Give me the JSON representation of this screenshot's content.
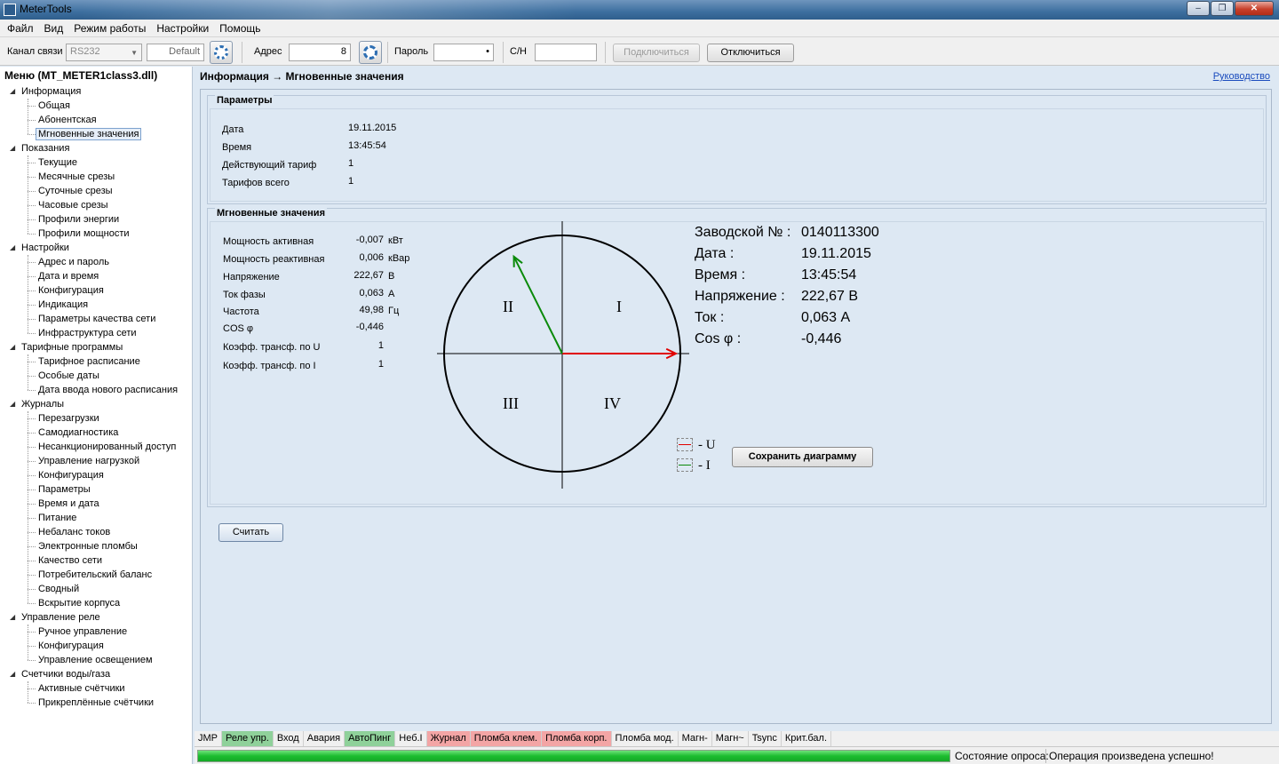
{
  "window": {
    "title": "MeterTools",
    "minimize": "–",
    "maximize": "❐",
    "close": "✕"
  },
  "menu": [
    "Файл",
    "Вид",
    "Режим работы",
    "Настройки",
    "Помощь"
  ],
  "toolbar": {
    "channel_label": "Канал связи",
    "channel_value": "RS232",
    "profile_value": "Default",
    "address_label": "Адрес",
    "address_value": "8",
    "password_label": "Пароль",
    "password_value": "•",
    "serial_label": "С/Н",
    "serial_value": "",
    "connect_label": "Подключиться",
    "disconnect_label": "Отключиться"
  },
  "sidebar": {
    "title": "Меню (MT_METER1class3.dll)",
    "groups": [
      {
        "label": "Информация",
        "items": [
          "Общая",
          "Абонентская",
          "Мгновенные значения"
        ],
        "selected": 2
      },
      {
        "label": "Показания",
        "items": [
          "Текущие",
          "Месячные срезы",
          "Суточные срезы",
          "Часовые срезы",
          "Профили энергии",
          "Профили мощности"
        ]
      },
      {
        "label": "Настройки",
        "items": [
          "Адрес и пароль",
          "Дата и время",
          "Конфигурация",
          "Индикация",
          "Параметры качества сети",
          "Инфраструктура сети"
        ]
      },
      {
        "label": "Тарифные программы",
        "items": [
          "Тарифное расписание",
          "Особые даты",
          "Дата ввода нового расписания"
        ]
      },
      {
        "label": "Журналы",
        "items": [
          "Перезагрузки",
          "Самодиагностика",
          "Несанкционированный доступ",
          "Управление нагрузкой",
          "Конфигурация",
          "Параметры",
          "Время и дата",
          "Питание",
          "Небаланс токов",
          "Электронные пломбы",
          "Качество сети",
          "Потребительский баланс",
          "Сводный",
          "Вскрытие корпуса"
        ]
      },
      {
        "label": "Управление реле",
        "items": [
          "Ручное управление",
          "Конфигурация",
          "Управление освещением"
        ]
      },
      {
        "label": "Счетчики воды/газа",
        "items": [
          "Активные счётчики",
          "Прикреплённые счётчики"
        ]
      }
    ]
  },
  "main": {
    "header": "Информация → Мгновенные значения",
    "help_link": "Руководство",
    "params": {
      "title": "Параметры",
      "rows": [
        {
          "label": "Дата",
          "value": "19.11.2015"
        },
        {
          "label": "Время",
          "value": "13:45:54"
        },
        {
          "label": "Действующий тариф",
          "value": "1"
        },
        {
          "label": "Тарифов всего",
          "value": "1"
        }
      ]
    },
    "instant": {
      "title": "Мгновенные значения",
      "rows": [
        {
          "label": "Мощность активная",
          "value": "-0,007",
          "unit": "кВт"
        },
        {
          "label": "Мощность реактивная",
          "value": "0,006",
          "unit": "кВар"
        },
        {
          "label": "Напряжение",
          "value": "222,67",
          "unit": "В"
        },
        {
          "label": "Ток фазы",
          "value": "0,063",
          "unit": "А"
        },
        {
          "label": "Частота",
          "value": "49,98",
          "unit": "Гц"
        },
        {
          "label": "COS φ",
          "value": "-0,446",
          "unit": ""
        },
        {
          "label": "Коэфф. трансф. по U",
          "value": "1",
          "unit": ""
        },
        {
          "label": "Коэфф. трансф. по I",
          "value": "1",
          "unit": ""
        }
      ]
    },
    "diagram": {
      "quadrants": [
        "I",
        "II",
        "III",
        "IV"
      ],
      "voltage_angle_deg": 0,
      "current_angle_deg": 116.5,
      "voltage_color": "#e00000",
      "current_color": "#0a8a0a",
      "legend_u": "- U",
      "legend_i": "- I",
      "save_button": "Сохранить диаграмму"
    },
    "summary": [
      {
        "label": "Заводской №  :",
        "value": "0140113300"
      },
      {
        "label": "Дата :",
        "value": "19.11.2015"
      },
      {
        "label": "Время :",
        "value": "13:45:54"
      },
      {
        "label": "Напряжение :",
        "value": "222,67 В"
      },
      {
        "label": "Ток :",
        "value": "0,063 А"
      },
      {
        "label": "Cos φ :",
        "value": "-0,446"
      }
    ],
    "read_button": "Считать"
  },
  "flags": [
    {
      "label": "JMP",
      "state": "none"
    },
    {
      "label": "Реле упр.",
      "state": "green"
    },
    {
      "label": "Вход",
      "state": "none"
    },
    {
      "label": "Авария",
      "state": "none"
    },
    {
      "label": "АвтоПинг",
      "state": "green"
    },
    {
      "label": "Неб.I",
      "state": "none"
    },
    {
      "label": "Журнал",
      "state": "red"
    },
    {
      "label": "Пломба клем.",
      "state": "red"
    },
    {
      "label": "Пломба корп.",
      "state": "red"
    },
    {
      "label": "Пломба мод.",
      "state": "none"
    },
    {
      "label": "Магн-",
      "state": "none"
    },
    {
      "label": "Магн~",
      "state": "none"
    },
    {
      "label": "Tsync",
      "state": "none"
    },
    {
      "label": "Крит.бал.",
      "state": "none"
    }
  ],
  "status": {
    "progress": 1.0,
    "label": "Состояние опроса:",
    "value": "Операция произведена успешно!"
  }
}
